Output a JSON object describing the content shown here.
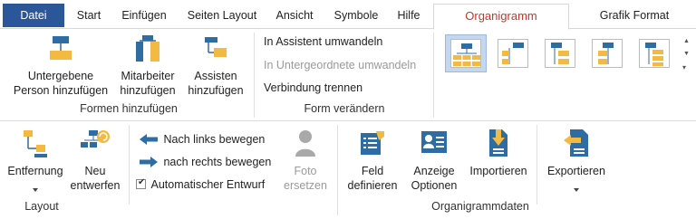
{
  "tabs": {
    "file": "Datei",
    "items": [
      "Start",
      "Einfügen",
      "Seiten Layout",
      "Ansicht",
      "Symbole",
      "Hilfe"
    ],
    "active": "Organigramm",
    "format": "Grafik Format"
  },
  "formen": {
    "untergebene": [
      "Untergebene",
      "Person hinzufügen"
    ],
    "mitarbeiter": [
      "Mitarbeiter",
      "hinzufügen"
    ],
    "assistent": [
      "Assisten",
      "hinzufügen"
    ],
    "group_label": "Formen hinzufügen"
  },
  "form_veraendern": {
    "assistent_umwandeln": "In Assistent umwandeln",
    "untergeordnete_umwandeln": "In Untergeordnete umwandeln",
    "verbindung_trennen": "Verbindung trennen",
    "group_label": "Form verändern"
  },
  "layout": {
    "entfernung": "Entfernung",
    "neu_entwerfen": [
      "Neu",
      "entwerfen"
    ],
    "nach_links": "Nach links bewegen",
    "nach_rechts": "nach rechts bewegen",
    "automatischer_entwurf": "Automatischer Entwurf",
    "foto_ersetzen": [
      "Foto",
      "ersetzen"
    ],
    "group_label": "Layout"
  },
  "organigrammdaten": {
    "feld": [
      "Feld",
      "definieren"
    ],
    "anzeige": [
      "Anzeige",
      "Optionen"
    ],
    "importieren": "Importieren",
    "exportieren": "Exportieren",
    "group_label": "Organigrammdaten"
  },
  "colors": {
    "file_tab": "#2b579a",
    "active_tab_text": "#c0392b",
    "icon_blue": "#2e6ca4",
    "icon_orange": "#f4b942",
    "selected_gallery": "#c5d7f0"
  }
}
